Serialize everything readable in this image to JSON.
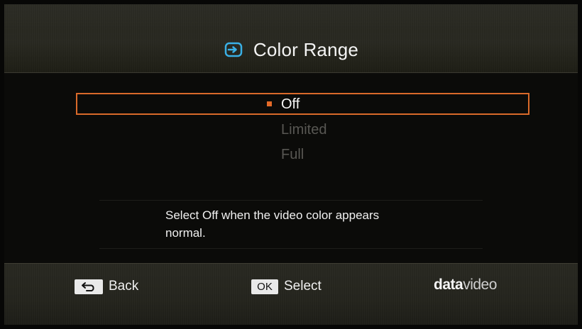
{
  "header": {
    "title": "Color Range",
    "icon": "input-icon"
  },
  "menu": {
    "options": [
      {
        "label": "Off",
        "state": "selected"
      },
      {
        "label": "Limited",
        "state": "disabled"
      },
      {
        "label": "Full",
        "state": "disabled"
      }
    ]
  },
  "description": {
    "line1": "Select Off when the video color appears",
    "line2": "normal."
  },
  "footer": {
    "back_key": "back-arrow-icon",
    "back_label": "Back",
    "ok_key": "OK",
    "select_label": "Select",
    "brand_bold": "data",
    "brand_light": "video"
  },
  "colors": {
    "accent": "#d96a2a",
    "icon": "#3ab0e6",
    "disabled_text": "#585753"
  }
}
